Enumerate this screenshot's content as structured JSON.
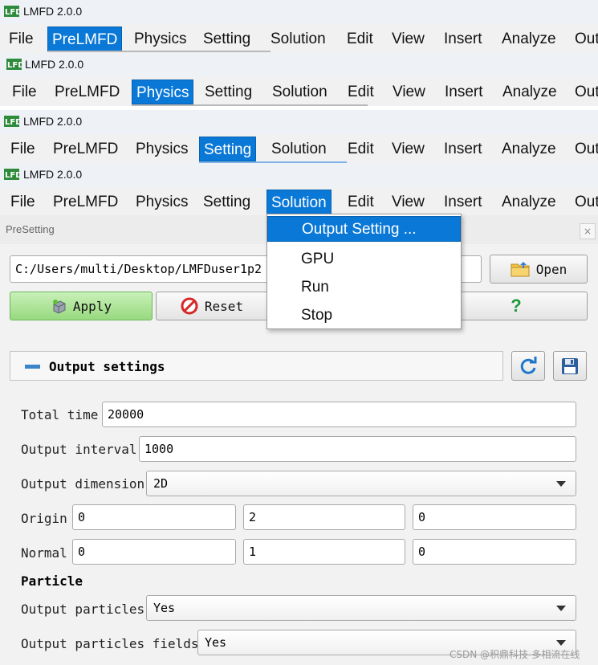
{
  "app_title": "LMFD 2.0.0",
  "menus": [
    "File",
    "PreLMFD",
    "Physics",
    "Setting",
    "Solution",
    "Edit",
    "View",
    "Insert",
    "Analyze",
    "Out"
  ],
  "snapshots": [
    {
      "active_menu": "PreLMFD"
    },
    {
      "active_menu": "Physics"
    },
    {
      "active_menu": "Setting"
    },
    {
      "active_menu": "Solution"
    }
  ],
  "dropdown": {
    "items": [
      "Output Setting ...",
      "GPU",
      "Run",
      "Stop"
    ],
    "highlighted": "Output Setting ..."
  },
  "panel": {
    "title": "PreSetting",
    "close_glyph": "×",
    "path_value": "C:/Users/multi/Desktop/LMFDuser1p2",
    "open_label": "Open",
    "apply_label": "Apply",
    "reset_label": "Reset",
    "help_label": "?",
    "section_title": "Output settings",
    "fields": {
      "total_time_label": "Total time",
      "total_time_value": "20000",
      "output_interval_label": "Output interval",
      "output_interval_value": "1000",
      "output_dimension_label": "Output dimension",
      "output_dimension_value": "2D",
      "origin_label": "Origin",
      "origin_values": [
        "0",
        "2",
        "0"
      ],
      "normal_label": "Normal",
      "normal_values": [
        "0",
        "1",
        "0"
      ],
      "particle_heading": "Particle",
      "output_particles_label": "Output particles",
      "output_particles_value": "Yes",
      "output_particles_fields_label": "Output particles fields",
      "output_particles_fields_value": "Yes"
    }
  },
  "watermark": "CSDN @积鼎科技-多相流在线",
  "colors": {
    "highlight": "#0a78d7",
    "apply_green": "#97d97f",
    "reset_red": "#d62828",
    "help_green": "#1c9a3a"
  }
}
